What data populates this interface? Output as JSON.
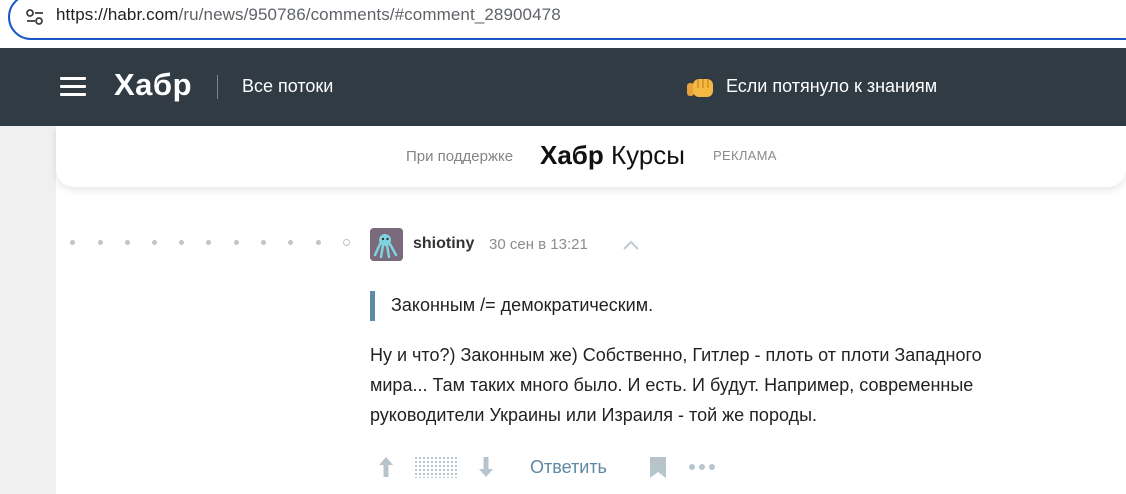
{
  "browser": {
    "url_host": "https://habr.com",
    "url_path": "/ru/news/950786/comments/#comment_28900478",
    "site_icon": "site-settings-icon"
  },
  "header": {
    "logo": "Хабр",
    "flows_label": "Все потоки",
    "promo_icon": "fist-emoji-icon",
    "promo_label": "Если потянуло к знаниям",
    "background": "#303b44"
  },
  "sponsor": {
    "support_text": "При поддержке",
    "logo_bold": "Хабр",
    "logo_rest": "Курсы",
    "ad_label": "РЕКЛАМА"
  },
  "comment": {
    "username": "shiotiny",
    "time": "30 сен в 13:21",
    "quote": "Законным /= демократическим.",
    "body_lines": [
      "Ну и что?) Законным же) Собственно, Гитлер - плоть от плоти Западного",
      "мира... Там таких много было. И есть. И будут. Например, современные",
      "руководители Украины или Израиля - той же породы."
    ],
    "actions": {
      "reply_label": "Ответить",
      "vote_up_icon": "arrow-up-icon",
      "vote_down_icon": "arrow-down-icon",
      "bookmark_icon": "bookmark-icon",
      "more_icon": "more-dots-icon"
    },
    "accent_color": "#5e87a3"
  }
}
